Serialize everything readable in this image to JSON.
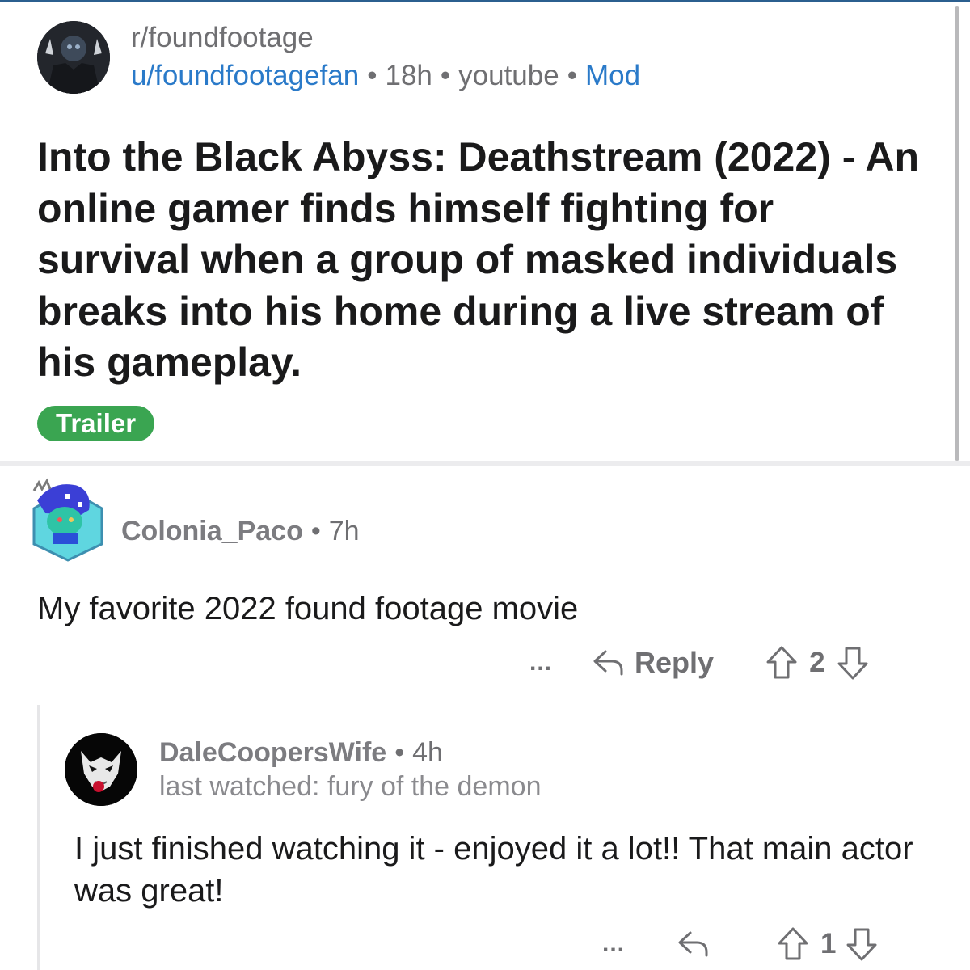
{
  "post": {
    "subreddit": "r/foundfootage",
    "author": "u/foundfootagefan",
    "age": "18h",
    "source": "youtube",
    "mod_label": "Mod",
    "title": "Into the Black Abyss: Deathstream (2022) - An online gamer finds himself fighting for survival when a group of masked individuals breaks into his home during a live stream of his gameplay.",
    "flair": "Trailer",
    "flair_color": "#3aa551"
  },
  "comments": [
    {
      "author": "Colonia_Paco",
      "age": "7h",
      "body": "My favorite 2022 found footage movie",
      "more_label": "...",
      "reply_label": "Reply",
      "votes": "2"
    },
    {
      "author": "DaleCoopersWife",
      "age": "4h",
      "flair": "last watched: fury of the demon",
      "body": "I just finished watching it - enjoyed it a lot!! That main actor was great!",
      "more_label": "...",
      "votes": "1"
    }
  ],
  "separator": "•",
  "colors": {
    "link": "#2a7ac9",
    "meta": "#6f6f72",
    "text": "#1a1a1b",
    "flair_bg": "#3aa551"
  },
  "icons": {
    "reply": "reply-arrow-icon",
    "upvote": "upvote-arrow-icon",
    "downvote": "downvote-arrow-icon",
    "more": "more-dots-icon"
  }
}
